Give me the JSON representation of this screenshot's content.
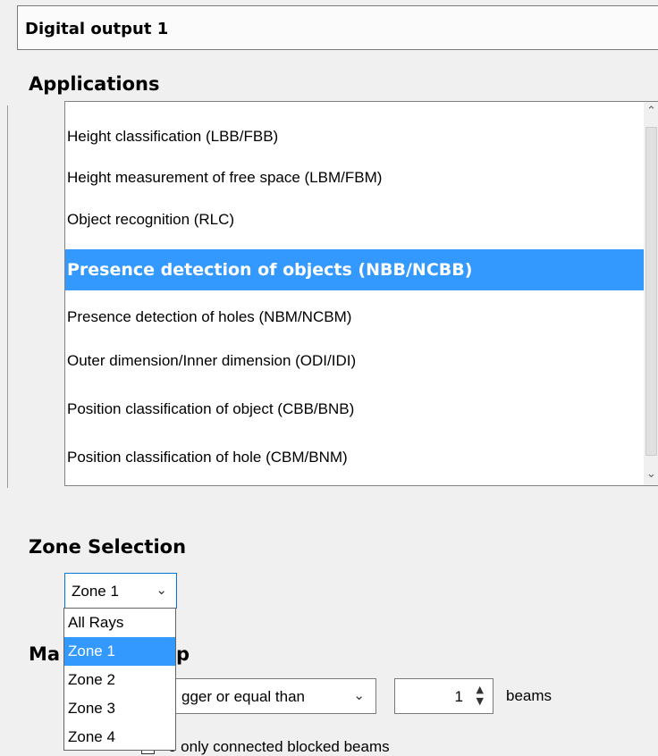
{
  "header": {
    "title": "Digital output 1"
  },
  "applications": {
    "heading": "Applications",
    "items": [
      "Height classification (LBB/FBB)",
      "Height measurement of free space (LBM/FBM)",
      "Object recognition (RLC)",
      "Presence detection of objects (NBB/NCBB)",
      "Presence detection of holes (NBM/NCBM)",
      "Outer dimension/Inner dimension (ODI/IDI)",
      "Position classification of object (CBB/BNB)",
      "Position classification of hole (CBM/BNM)"
    ],
    "selected_index": 3
  },
  "zone_selection": {
    "heading": "Zone Selection",
    "value": "Zone 1",
    "options": [
      "All Rays",
      "Zone 1",
      "Zone 2",
      "Zone 3",
      "Zone 4"
    ],
    "selected_index": 1
  },
  "match_section": {
    "heading_visible": "Ma",
    "heading_visible_end": "p",
    "condition_value": "bigger or equal than",
    "condition_visible": "gger or equal than",
    "count_value": "1",
    "unit": "beams",
    "checkbox_label_visible": "e only connected blocked beams"
  },
  "colors": {
    "selection": "#3399ff",
    "focus_border": "#0078d7"
  },
  "icons": [
    "chevron-down-icon",
    "chevron-up-icon",
    "spin-updown-icon"
  ]
}
